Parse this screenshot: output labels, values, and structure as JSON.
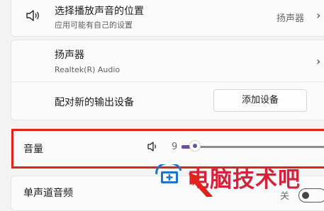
{
  "output_device": {
    "title": "选择播放声音的位置",
    "subtitle": "应用可能有自己的设置",
    "value": "扬声器"
  },
  "speaker": {
    "title": "扬声器",
    "subtitle": "Realtek(R) Audio"
  },
  "pair": {
    "label": "配对新的输出设备",
    "button": "添加设备"
  },
  "volume": {
    "label": "音量",
    "value": "9",
    "level_percent": 9
  },
  "mono": {
    "label": "单声道音频",
    "state": "关"
  },
  "watermark": {
    "text": "电脑技术吧"
  },
  "colors": {
    "accent": "#6b4fa0",
    "highlight": "#e0241b",
    "watermark": "#d7213a"
  }
}
